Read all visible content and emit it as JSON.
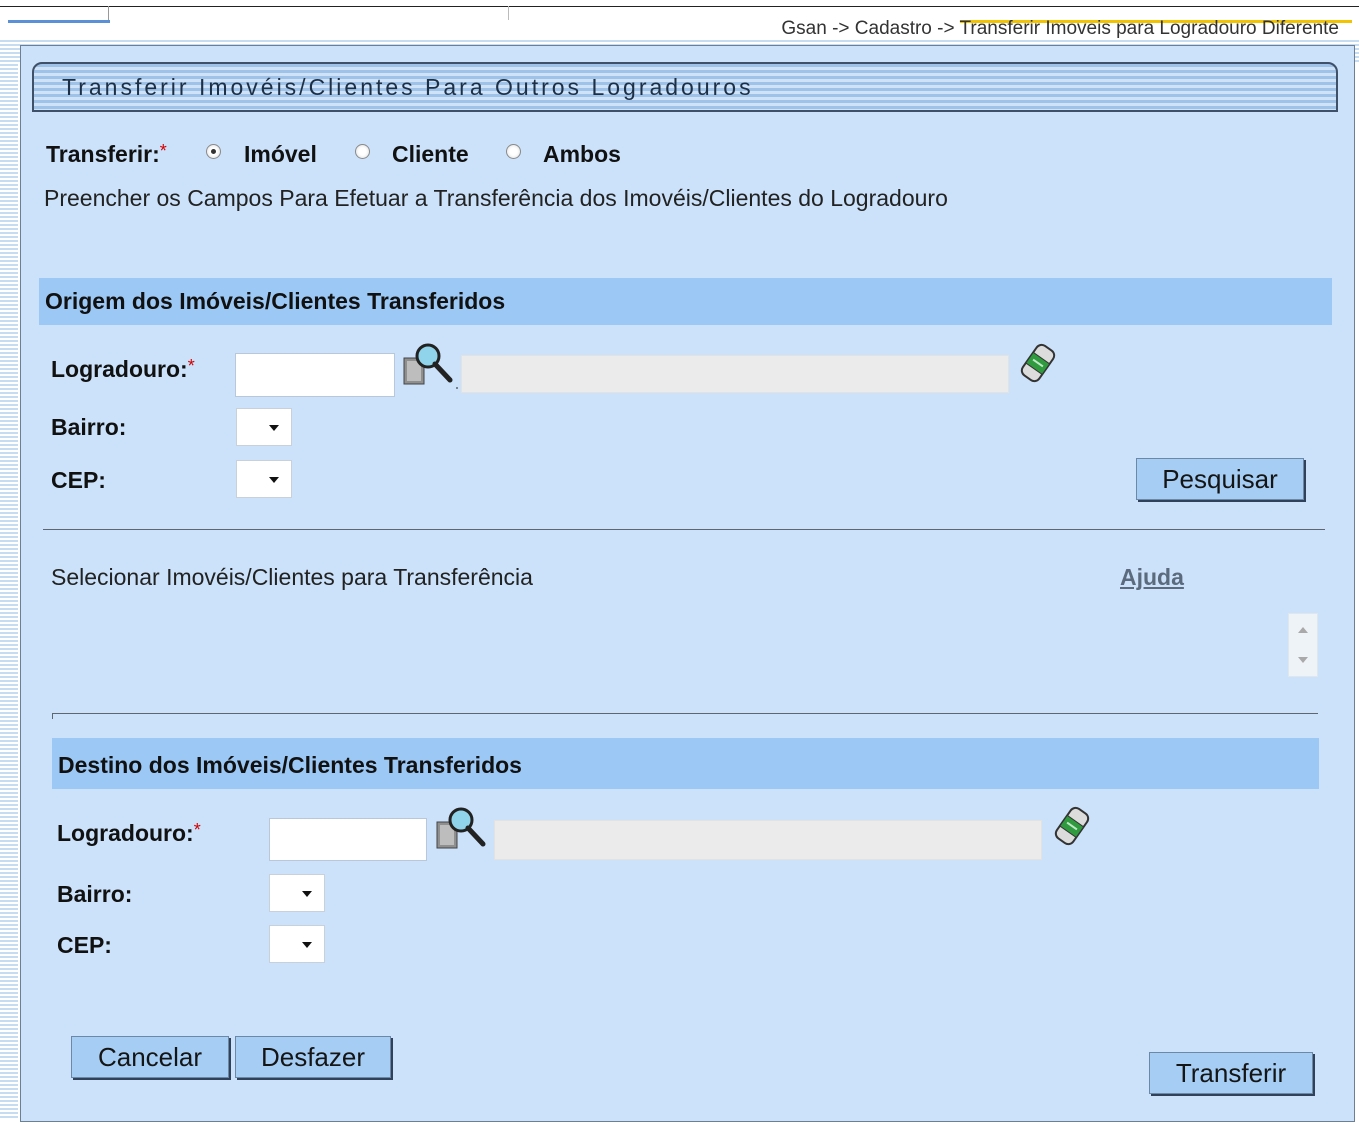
{
  "breadcrumb": "Gsan -> Cadastro -> Transferir Imoveis para Logradouro Diferente",
  "title": "Transferir Imovéis/Clientes Para Outros Logradouros",
  "transferir": {
    "label": "Transferir:",
    "required_mark": "*",
    "options": [
      "Imóvel",
      "Cliente",
      "Ambos"
    ],
    "selected": "Imóvel"
  },
  "instructions": "Preencher os Campos Para Efetuar a Transferência dos Imovéis/Clientes do Logradouro",
  "origem": {
    "header": "Origem dos Imóveis/Clientes Transferidos",
    "logradouro_label": "Logradouro:",
    "required_mark": "*",
    "logradouro_value": "",
    "logradouro_desc": "",
    "bairro_label": "Bairro:",
    "bairro_value": "",
    "cep_label": "CEP:",
    "cep_value": "",
    "pesquisar_label": "Pesquisar"
  },
  "selecao": {
    "label": "Selecionar Imovéis/Clientes para Transferência",
    "ajuda_label": "Ajuda"
  },
  "destino": {
    "header": "Destino dos Imóveis/Clientes Transferidos",
    "logradouro_label": "Logradouro:",
    "required_mark": "*",
    "logradouro_value": "",
    "logradouro_desc": "",
    "bairro_label": "Bairro:",
    "bairro_value": "",
    "cep_label": "CEP:",
    "cep_value": ""
  },
  "actions": {
    "cancelar_label": "Cancelar",
    "desfazer_label": "Desfazer",
    "transferir_label": "Transferir"
  },
  "icons": {
    "search": "search-magnifier-icon",
    "clear": "eraser-icon"
  },
  "colors": {
    "panel_bg": "#cbe2fa",
    "section_header_bg": "#9cc8f5",
    "button_bg": "#a6cdf4",
    "required": "#d40000"
  }
}
